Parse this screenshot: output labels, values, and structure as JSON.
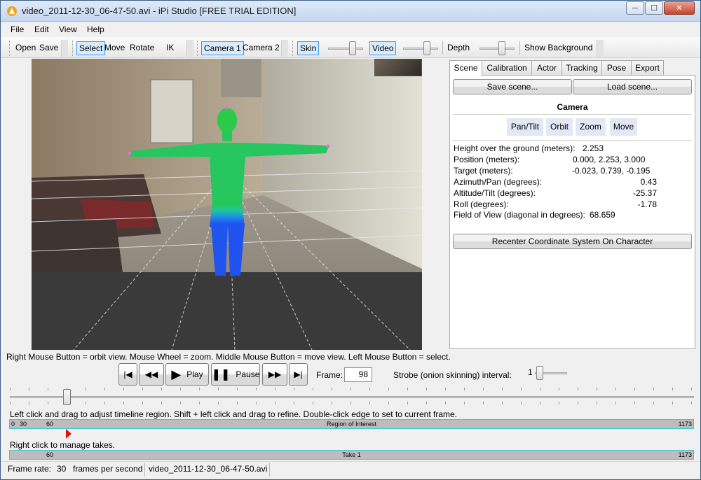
{
  "window": {
    "title": "video_2011-12-30_06-47-50.avi - iPi Studio [FREE TRIAL EDITION]",
    "controls": {
      "minimize": "─",
      "maximize": "☐",
      "close": "✕"
    }
  },
  "menu": {
    "file": "File",
    "edit": "Edit",
    "view": "View",
    "help": "Help"
  },
  "toolbar": {
    "open": "Open",
    "save": "Save",
    "select": "Select",
    "move": "Move",
    "rotate": "Rotate",
    "ik": "IK",
    "camera1": "Camera 1",
    "camera2": "Camera 2",
    "skin": "Skin",
    "video": "Video",
    "depth": "Depth",
    "show_background": "Show Background"
  },
  "panel": {
    "tabs": [
      "Scene",
      "Calibration",
      "Actor",
      "Tracking",
      "Pose",
      "Export"
    ],
    "save_scene": "Save scene...",
    "load_scene": "Load scene...",
    "camera_heading": "Camera",
    "nav_buttons": [
      "Pan/Tilt",
      "Orbit",
      "Zoom",
      "Move"
    ],
    "height_label": "Height over the ground (meters):",
    "height_value": "2.253",
    "position_label": "Position (meters):",
    "position_value": "0.000, 2.253, 3.000",
    "target_label": "Target (meters):",
    "target_value": "-0.023, 0.739, -0.195",
    "azimuth_label": "Azimuth/Pan (degrees):",
    "azimuth_value": "0.43",
    "altitude_label": "Altitude/Tilt (degrees):",
    "altitude_value": "-25.37",
    "roll_label": "Roll (degrees):",
    "roll_value": "-1.78",
    "fov_label": "Field of View (diagonal in degrees):",
    "fov_value": "68.659",
    "recenter": "Recenter Coordinate System On Character"
  },
  "hints": {
    "mouse": "Right Mouse Button = orbit view. Mouse Wheel = zoom. Middle Mouse Button = move view. Left Mouse Button = select.",
    "timeline": "Left click and drag to adjust timeline region. Shift + left click and drag to refine. Double-click edge to set to current frame.",
    "takes": "Right click to manage takes."
  },
  "playback": {
    "play": "Play",
    "pause": "Pause",
    "frame_label": "Frame:",
    "frame_value": "98",
    "strobe_label": "Strobe (onion skinning) interval:",
    "strobe_value": "1"
  },
  "roi": {
    "start": "0",
    "start2": "30",
    "mark": "60",
    "label": "Region of Interest",
    "end": "1173"
  },
  "take": {
    "start": "60",
    "label": "Take 1",
    "end": "1173"
  },
  "status": {
    "frame_rate_label": "Frame rate:",
    "frame_rate_value": "30",
    "fps_unit": "frames per second",
    "file": "video_2011-12-30_06-47-50.avi"
  }
}
